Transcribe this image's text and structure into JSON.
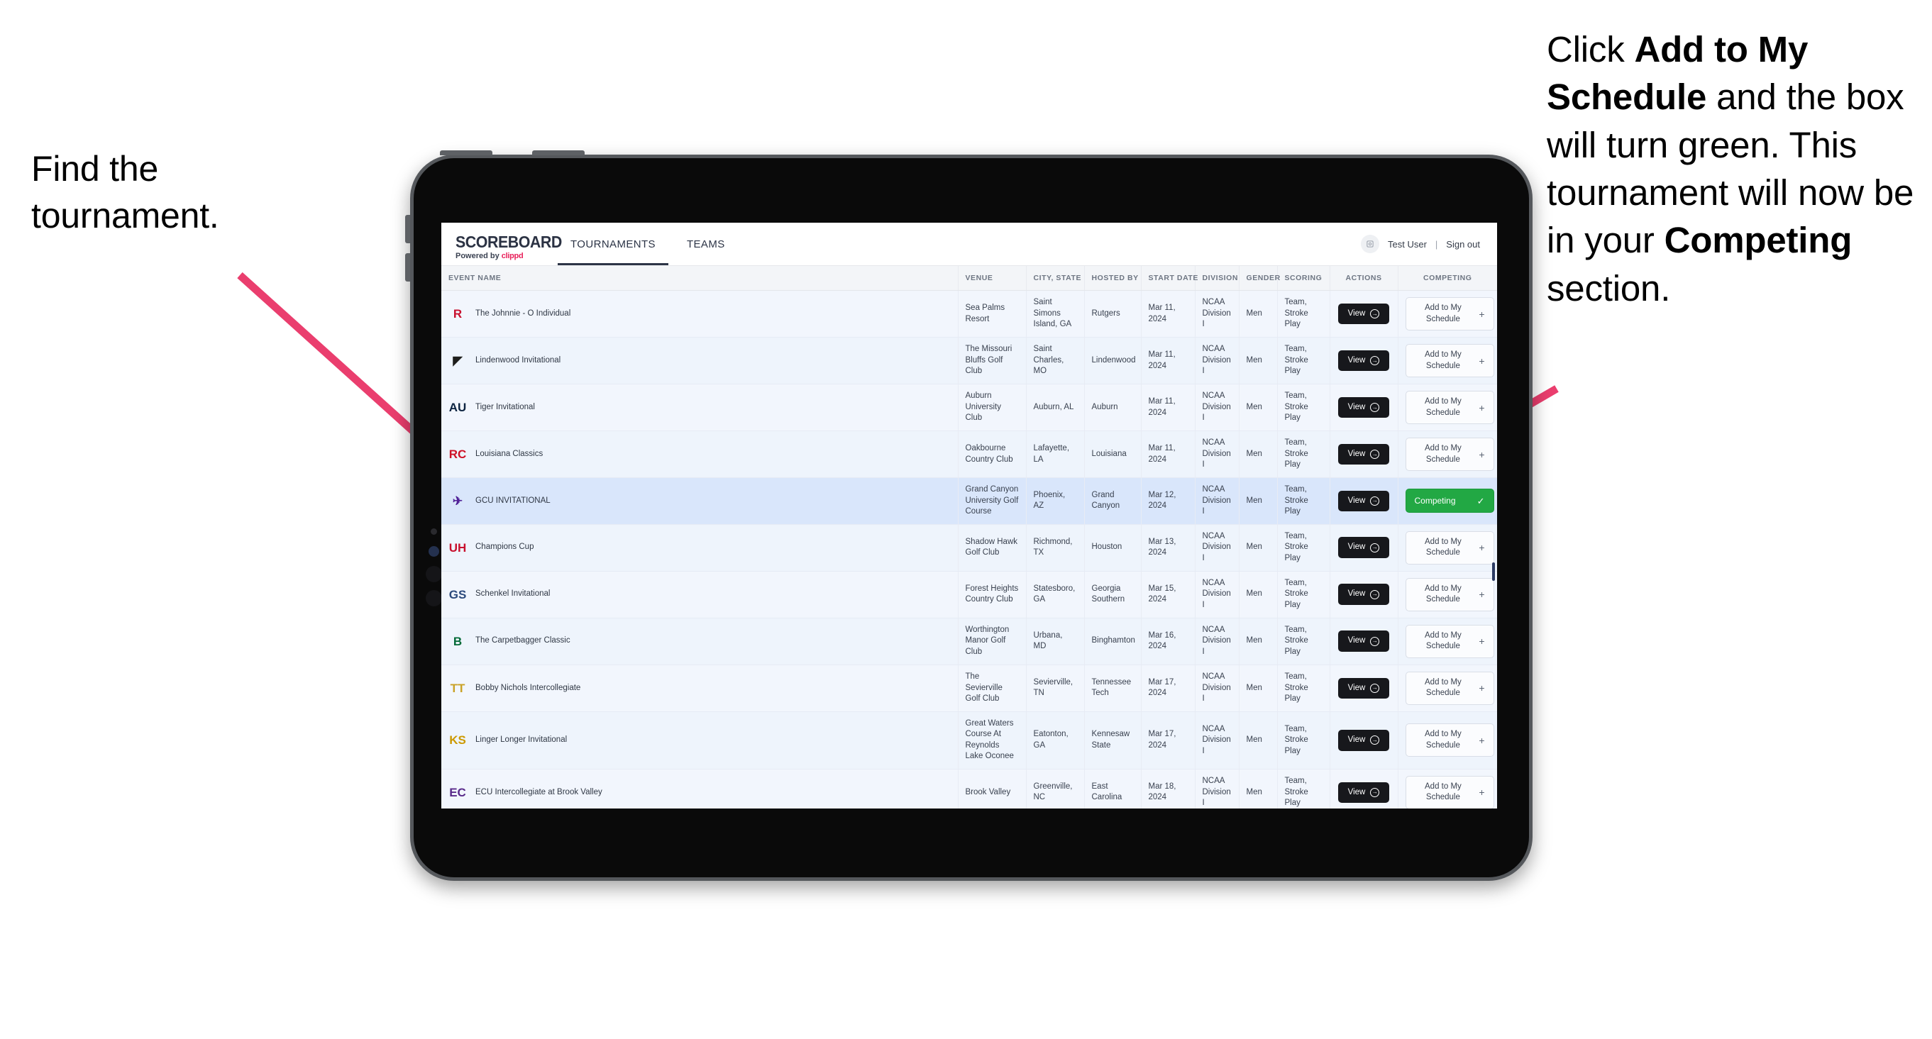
{
  "annotations": {
    "left": {
      "line1": "Find the",
      "line2": "tournament."
    },
    "right": {
      "pre": "Click ",
      "bold1": "Add to My Schedule",
      "mid": " and the box will turn green. This tournament will now be in your ",
      "bold2": "Competing",
      "post": " section."
    }
  },
  "app": {
    "logo": {
      "word": "SCOREBOARD",
      "powered_prefix": "Powered by ",
      "brand": "clippd"
    },
    "nav": [
      {
        "label": "TOURNAMENTS",
        "active": true
      },
      {
        "label": "TEAMS",
        "active": false
      }
    ],
    "account": {
      "avatar_icon": "user-avatar-icon",
      "user": "Test User",
      "divider": "|",
      "sign_out": "Sign out"
    },
    "table": {
      "columns": [
        "EVENT NAME",
        "VENUE",
        "CITY, STATE",
        "HOSTED BY",
        "START DATE",
        "DIVISION",
        "GENDER",
        "SCORING",
        "ACTIONS",
        "COMPETING"
      ],
      "view_label": "View",
      "add_label": "Add to My Schedule",
      "add_plus": "+",
      "competing_label": "Competing",
      "competing_check": "✓",
      "rows": [
        {
          "logo_text": "R",
          "logo_color": "#c8102e",
          "logo_bg": "transparent",
          "event": "The Johnnie - O Individual",
          "venue": "Sea Palms Resort",
          "city": "Saint Simons Island, GA",
          "host": "Rutgers",
          "date": "Mar 11, 2024",
          "division": "NCAA Division I",
          "gender": "Men",
          "scoring": "Team, Stroke Play",
          "competing": false
        },
        {
          "logo_text": "◤",
          "logo_color": "#1d1d1b",
          "logo_bg": "transparent",
          "event": "Lindenwood Invitational",
          "venue": "The Missouri Bluffs Golf Club",
          "city": "Saint Charles, MO",
          "host": "Lindenwood",
          "date": "Mar 11, 2024",
          "division": "NCAA Division I",
          "gender": "Men",
          "scoring": "Team, Stroke Play",
          "competing": false
        },
        {
          "logo_text": "AU",
          "logo_color": "#0c2340",
          "logo_bg": "transparent",
          "event": "Tiger Invitational",
          "venue": "Auburn University Club",
          "city": "Auburn, AL",
          "host": "Auburn",
          "date": "Mar 11, 2024",
          "division": "NCAA Division I",
          "gender": "Men",
          "scoring": "Team, Stroke Play",
          "competing": false
        },
        {
          "logo_text": "RC",
          "logo_color": "#ce1126",
          "logo_bg": "transparent",
          "event": "Louisiana Classics",
          "venue": "Oakbourne Country Club",
          "city": "Lafayette, LA",
          "host": "Louisiana",
          "date": "Mar 11, 2024",
          "division": "NCAA Division I",
          "gender": "Men",
          "scoring": "Team, Stroke Play",
          "competing": false
        },
        {
          "logo_text": "✈",
          "logo_color": "#522398",
          "logo_bg": "transparent",
          "event": "GCU INVITATIONAL",
          "venue": "Grand Canyon University Golf Course",
          "city": "Phoenix, AZ",
          "host": "Grand Canyon",
          "date": "Mar 12, 2024",
          "division": "NCAA Division I",
          "gender": "Men",
          "scoring": "Team, Stroke Play",
          "competing": true,
          "selected": true
        },
        {
          "logo_text": "UH",
          "logo_color": "#c8102e",
          "logo_bg": "transparent",
          "event": "Champions Cup",
          "venue": "Shadow Hawk Golf Club",
          "city": "Richmond, TX",
          "host": "Houston",
          "date": "Mar 13, 2024",
          "division": "NCAA Division I",
          "gender": "Men",
          "scoring": "Team, Stroke Play",
          "competing": false
        },
        {
          "logo_text": "GS",
          "logo_color": "#2c4a7c",
          "logo_bg": "transparent",
          "event": "Schenkel Invitational",
          "venue": "Forest Heights Country Club",
          "city": "Statesboro, GA",
          "host": "Georgia Southern",
          "date": "Mar 15, 2024",
          "division": "NCAA Division I",
          "gender": "Men",
          "scoring": "Team, Stroke Play",
          "competing": false
        },
        {
          "logo_text": "B",
          "logo_color": "#046a38",
          "logo_bg": "transparent",
          "event": "The Carpetbagger Classic",
          "venue": "Worthington Manor Golf Club",
          "city": "Urbana, MD",
          "host": "Binghamton",
          "date": "Mar 16, 2024",
          "division": "NCAA Division I",
          "gender": "Men",
          "scoring": "Team, Stroke Play",
          "competing": false
        },
        {
          "logo_text": "TT",
          "logo_color": "#c9a227",
          "logo_bg": "transparent",
          "event": "Bobby Nichols Intercollegiate",
          "venue": "The Sevierville Golf Club",
          "city": "Sevierville, TN",
          "host": "Tennessee Tech",
          "date": "Mar 17, 2024",
          "division": "NCAA Division I",
          "gender": "Men",
          "scoring": "Team, Stroke Play",
          "competing": false
        },
        {
          "logo_text": "KS",
          "logo_color": "#cc9900",
          "logo_bg": "transparent",
          "event": "Linger Longer Invitational",
          "venue": "Great Waters Course At Reynolds Lake Oconee",
          "city": "Eatonton, GA",
          "host": "Kennesaw State",
          "date": "Mar 17, 2024",
          "division": "NCAA Division I",
          "gender": "Men",
          "scoring": "Team, Stroke Play",
          "competing": false
        },
        {
          "logo_text": "EC",
          "logo_color": "#592a8a",
          "logo_bg": "transparent",
          "event": "ECU Intercollegiate at Brook Valley",
          "venue": "Brook Valley",
          "city": "Greenville, NC",
          "host": "East Carolina",
          "date": "Mar 18, 2024",
          "division": "NCAA Division I",
          "gender": "Men",
          "scoring": "Team, Stroke Play",
          "competing": false
        }
      ]
    }
  },
  "colors": {
    "accent_pink": "#ea3e6e",
    "competing_green": "#22a844",
    "brand_red": "#e8205a",
    "dark": "#17181c"
  }
}
